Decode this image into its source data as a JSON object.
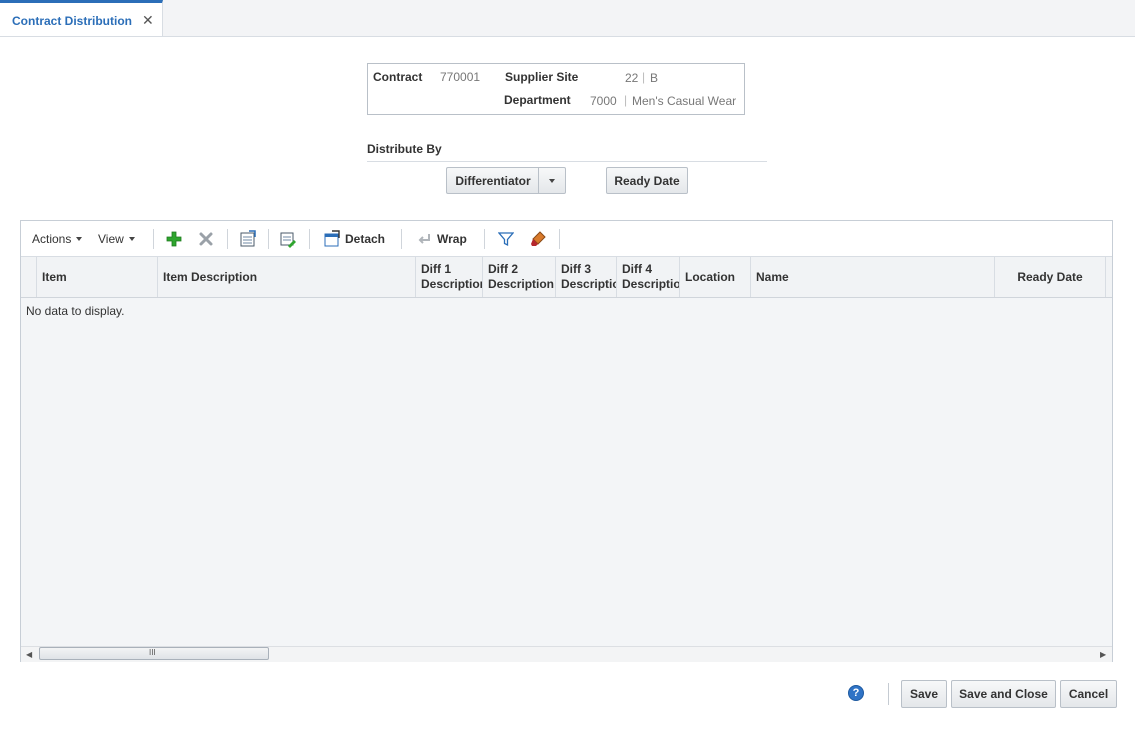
{
  "tab": {
    "label": "Contract Distribution",
    "close_glyph": "✕"
  },
  "header": {
    "contract_label": "Contract",
    "contract_value": "770001",
    "supplier_site_label": "Supplier Site",
    "supplier_site_id": "22",
    "supplier_site_name": "B",
    "department_label": "Department",
    "department_id": "7000",
    "department_name": "Men's Casual Wear"
  },
  "distribute": {
    "title": "Distribute By",
    "differentiator_label": "Differentiator",
    "ready_date_label": "Ready Date"
  },
  "toolbar": {
    "actions_label": "Actions",
    "view_label": "View",
    "detach_label": "Detach",
    "wrap_label": "Wrap",
    "icons": [
      "add-icon",
      "delete-icon",
      "export-icon",
      "edit-icon",
      "detach-icon",
      "wrap-icon",
      "filter-icon",
      "eraser-icon"
    ]
  },
  "table": {
    "columns": {
      "item": "Item",
      "item_description": "Item Description",
      "diff1_a": "Diff 1",
      "diff1_b": "Description",
      "diff2_a": "Diff 2",
      "diff2_b": "Description",
      "diff3_a": "Diff 3",
      "diff3_b": "Description",
      "diff4_a": "Diff 4",
      "diff4_b": "Description",
      "location": "Location",
      "name": "Name",
      "ready_date": "Ready Date"
    },
    "empty_text": "No data to display.",
    "scroll_grip": "III"
  },
  "footer": {
    "help_glyph": "?",
    "save_label": "Save",
    "save_close_label": "Save and Close",
    "cancel_label": "Cancel"
  },
  "colors": {
    "accent": "#2b6eb8",
    "add_green": "#2ea52e"
  }
}
